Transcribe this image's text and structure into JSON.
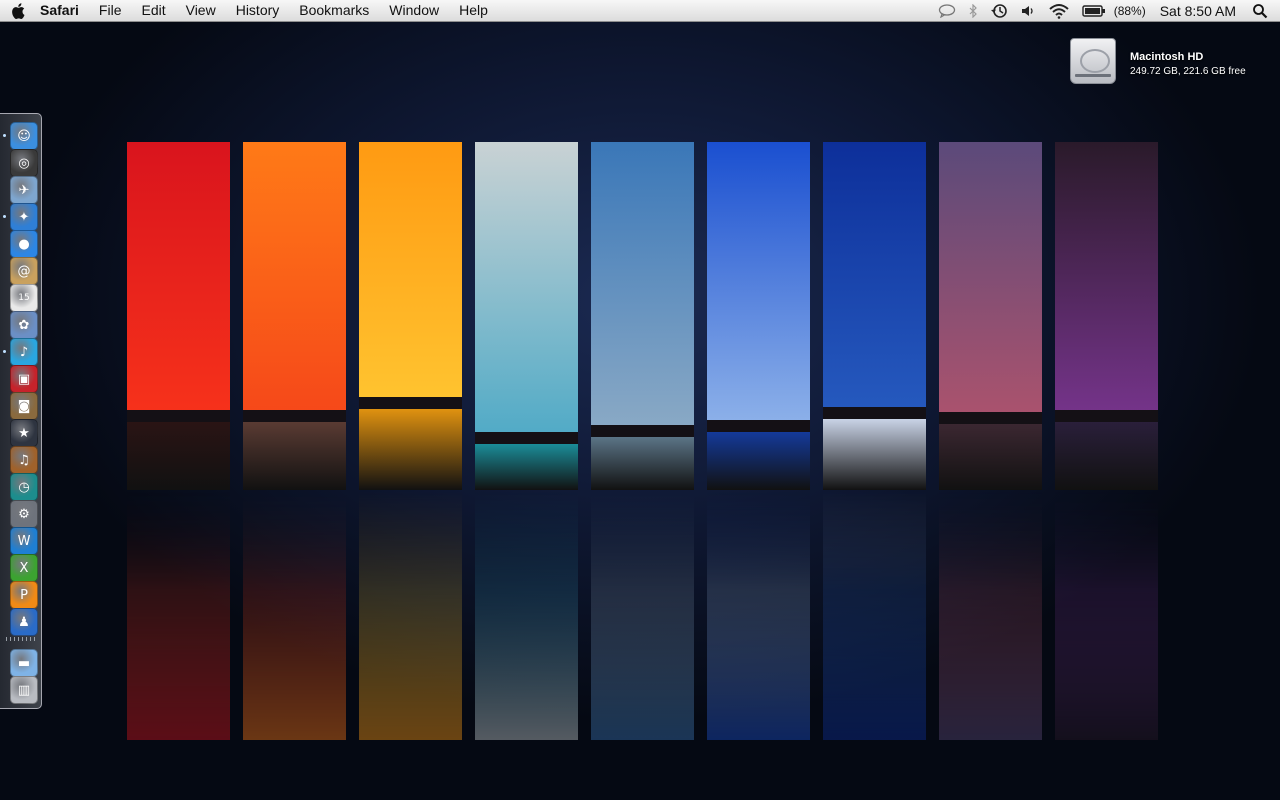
{
  "menubar": {
    "app_name": "Safari",
    "menus": [
      "File",
      "Edit",
      "View",
      "History",
      "Bookmarks",
      "Window",
      "Help"
    ],
    "status": {
      "battery_percent": "(88%)",
      "clock": "Sat 8:50 AM"
    },
    "icons": [
      "apple-icon",
      "speech-bubble-icon",
      "bluetooth-icon",
      "time-machine-icon",
      "volume-icon",
      "wifi-icon",
      "battery-icon",
      "spotlight-icon"
    ]
  },
  "desktop": {
    "hard_drive": {
      "name": "Macintosh HD",
      "info": "249.72 GB, 221.6 GB free"
    }
  },
  "dock": {
    "items": [
      {
        "name": "finder-icon",
        "glyph": "☺",
        "color": "#3b8fe0",
        "running": true
      },
      {
        "name": "dashboard-icon",
        "glyph": "◎",
        "color": "#3a3a3a",
        "running": false
      },
      {
        "name": "mail-icon",
        "glyph": "✈",
        "color": "#7ea6cf",
        "running": false
      },
      {
        "name": "safari-icon",
        "glyph": "✦",
        "color": "#2f7fd6",
        "running": true
      },
      {
        "name": "ichat-icon",
        "glyph": "●",
        "color": "#2d86e4",
        "running": false
      },
      {
        "name": "address-book-icon",
        "glyph": "@",
        "color": "#c9a15e",
        "running": false
      },
      {
        "name": "ical-icon",
        "glyph": "15",
        "color": "#e9e9e9",
        "running": false
      },
      {
        "name": "iphoto-icon",
        "glyph": "✿",
        "color": "#6b8fc5",
        "running": false
      },
      {
        "name": "itunes-icon",
        "glyph": "♪",
        "color": "#2aa6e0",
        "running": true
      },
      {
        "name": "photo-booth-icon",
        "glyph": "▣",
        "color": "#c6232b",
        "running": false
      },
      {
        "name": "preview-icon",
        "glyph": "◙",
        "color": "#8a6a3e",
        "running": false
      },
      {
        "name": "imovie-icon",
        "glyph": "★",
        "color": "#2e3440",
        "running": false
      },
      {
        "name": "garageband-icon",
        "glyph": "♫",
        "color": "#a0622b",
        "running": false
      },
      {
        "name": "time-machine-icon",
        "glyph": "◷",
        "color": "#1d8d8d",
        "running": false
      },
      {
        "name": "system-preferences-icon",
        "glyph": "⚙",
        "color": "#6e737c",
        "running": false
      },
      {
        "name": "iweb-icon",
        "glyph": "W",
        "color": "#1f7fd3",
        "running": false
      },
      {
        "name": "xcode-game-icon",
        "glyph": "X",
        "color": "#3ca331",
        "running": false
      },
      {
        "name": "pages-icon",
        "glyph": "P",
        "color": "#f08a16",
        "running": false
      },
      {
        "name": "user-icon",
        "glyph": "♟",
        "color": "#2a6bc7",
        "running": false
      },
      {
        "name": "applications-folder-icon",
        "glyph": "▬",
        "color": "#7fb3e6",
        "running": false
      },
      {
        "name": "trash-icon",
        "glyph": "▥",
        "color": "#b9bcc2",
        "running": false
      }
    ]
  },
  "wallpaper": {
    "strips": [
      {
        "sky_top": "#d9141d",
        "sky_bottom": "#ff3a1a",
        "sea": "#2a1414"
      },
      {
        "sky_top": "#ff7a17",
        "sky_bottom": "#f33a1a",
        "sea": "#5a3b33"
      },
      {
        "sky_top": "#ff9a12",
        "sky_bottom": "#ffd23a",
        "sea": "#e09210"
      },
      {
        "sky_top": "#c9d2d4",
        "sky_bottom": "#3aa3c4",
        "sea": "#1b8c98"
      },
      {
        "sky_top": "#3a77b8",
        "sky_bottom": "#9bb4c8",
        "sea": "#5b7486"
      },
      {
        "sky_top": "#1a4fd0",
        "sky_bottom": "#a8c8ef",
        "sea": "#143a9a"
      },
      {
        "sky_top": "#0d2f9a",
        "sky_bottom": "#2d66c9",
        "sea": "#c9d3e6"
      },
      {
        "sky_top": "#5b4a7a",
        "sky_bottom": "#c0556a",
        "sea": "#3b2731"
      },
      {
        "sky_top": "#2a1a2a",
        "sky_bottom": "#8a3ba5",
        "sea": "#2a1f3a"
      }
    ]
  }
}
